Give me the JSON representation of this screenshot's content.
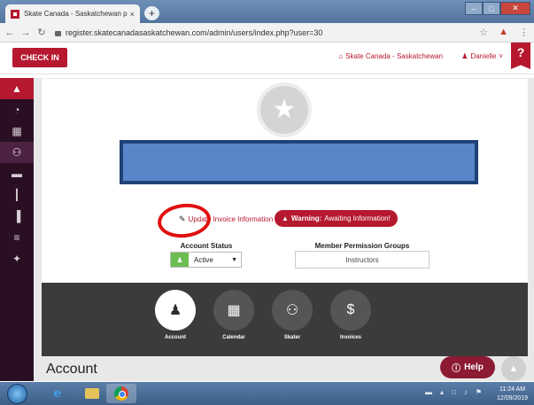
{
  "browser": {
    "tab_title": "Skate Canada - Saskatchewan p",
    "tab_close": "×",
    "new_tab": "+",
    "url": "register.skatecanadasaskatchewan.com/admin/users/index.php?user=30",
    "window_controls": {
      "minimize": "–",
      "maximize": "□",
      "close": "✕"
    }
  },
  "header": {
    "checkin_label": "CHECK IN",
    "org_link": "Skate Canada - Saskatchewan",
    "user_name": "Danielle",
    "help_tag": "?"
  },
  "sidebar": {
    "items": [
      {
        "icon": "warning-icon",
        "glyph": "▲"
      },
      {
        "icon": "dashboard-icon",
        "glyph": "◔"
      },
      {
        "icon": "calculator-icon",
        "glyph": "▦"
      },
      {
        "icon": "users-icon",
        "glyph": "⚇"
      },
      {
        "icon": "chat-icon",
        "glyph": "▬"
      },
      {
        "icon": "barcode-icon",
        "glyph": "┃"
      },
      {
        "icon": "bar-chart-icon",
        "glyph": "▐"
      },
      {
        "icon": "sliders-icon",
        "glyph": "≡"
      },
      {
        "icon": "magic-icon",
        "glyph": "✦"
      }
    ]
  },
  "profile": {
    "update_link": "Update Invoice Information",
    "warning_bold": "Warning:",
    "warning_text": "Awaiting Information!",
    "account_status_label": "Account Status",
    "account_status_value": "Active",
    "permission_groups_label": "Member Permission Groups",
    "permission_group_value": "Instructors"
  },
  "tabs": [
    {
      "label": "Account",
      "glyph": "♟"
    },
    {
      "label": "Calendar",
      "glyph": "▦"
    },
    {
      "label": "Skater",
      "glyph": "⚇"
    },
    {
      "label": "Invoices",
      "glyph": "$"
    }
  ],
  "section_heading": "Account",
  "help_button": "Help",
  "taskbar": {
    "time": "11:24 AM",
    "date": "12/09/2019"
  }
}
